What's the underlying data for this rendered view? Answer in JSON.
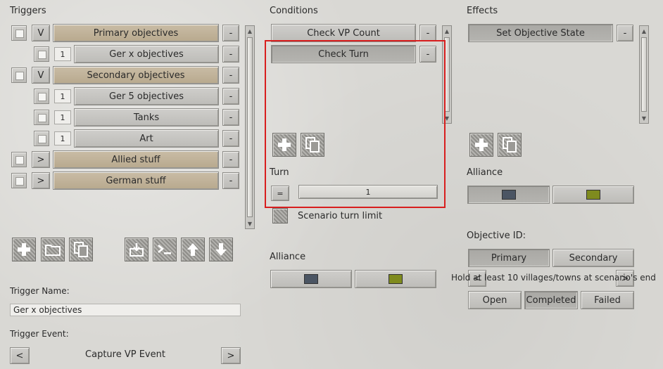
{
  "triggers": {
    "title": "Triggers",
    "items": [
      {
        "expander": "V",
        "label": "Primary objectives",
        "remove": "-"
      },
      {
        "num": "1",
        "label": "Ger x objectives",
        "remove": "-"
      },
      {
        "expander": "V",
        "label": "Secondary objectives",
        "remove": "-"
      },
      {
        "num": "1",
        "label": "Ger 5 objectives",
        "remove": "-"
      },
      {
        "num": "1",
        "label": "Tanks",
        "remove": "-"
      },
      {
        "num": "1",
        "label": "Art",
        "remove": "-"
      },
      {
        "expander": ">",
        "label": "Allied stuff",
        "remove": "-"
      },
      {
        "expander": ">",
        "label": "German stuff",
        "remove": "-"
      }
    ],
    "toolbar_icons": [
      "add-icon",
      "folder-icon",
      "copy-icon",
      "import-icon",
      "console-icon",
      "move-up-icon",
      "move-down-icon"
    ],
    "name_label": "Trigger Name:",
    "name_value": "Ger x objectives",
    "event_label": "Trigger Event:",
    "event_prev": "<",
    "event_value": "Capture VP Event",
    "event_next": ">"
  },
  "conditions": {
    "title": "Conditions",
    "items": [
      {
        "label": "Check VP Count",
        "remove": "-"
      },
      {
        "label": "Check Turn",
        "remove": "-"
      }
    ],
    "turn_label": "Turn",
    "turn_operator": "=",
    "turn_value": "1",
    "scenario_limit_label": "Scenario turn limit",
    "alliance_label": "Alliance",
    "alliance_colors": [
      "#4b5563",
      "#7f8b1e"
    ]
  },
  "effects": {
    "title": "Effects",
    "items": [
      {
        "label": "Set Objective State",
        "remove": "-"
      }
    ],
    "alliance_label": "Alliance",
    "alliance_colors": [
      "#4b5563",
      "#7f8b1e"
    ],
    "objective_label": "Objective ID:",
    "objective_primary": "Primary",
    "objective_secondary": "Secondary",
    "objective_prev": "<",
    "objective_next": ">",
    "objective_text": "Hold at least 10 villages/towns at scenario's end",
    "state_open": "Open",
    "state_completed": "Completed",
    "state_failed": "Failed"
  },
  "colors": {
    "highlight": "#d81e1e",
    "tan": "#c0b298"
  }
}
